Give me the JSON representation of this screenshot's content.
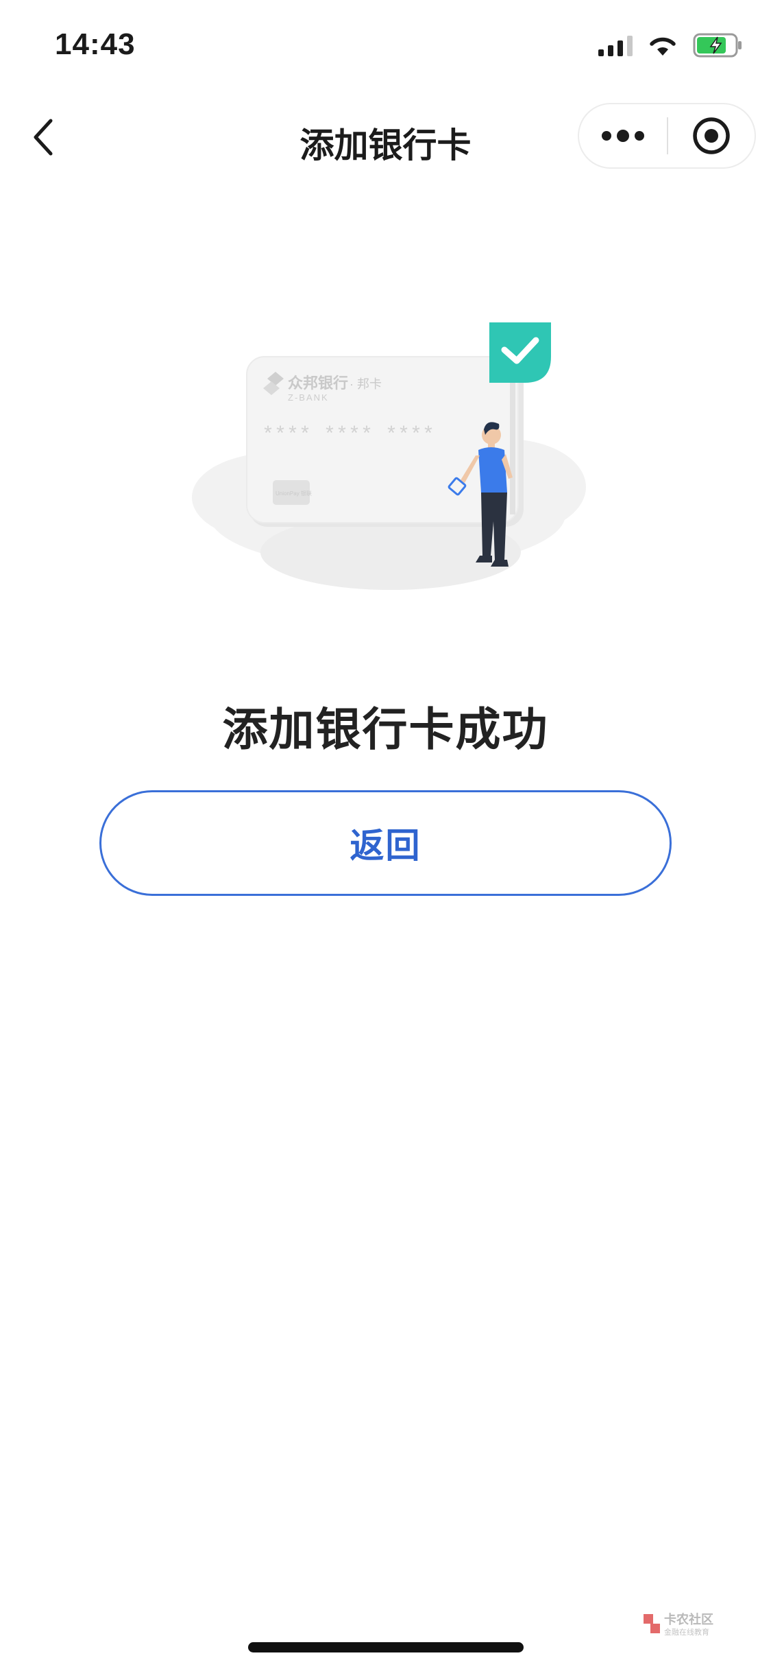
{
  "status_bar": {
    "time": "14:43"
  },
  "nav": {
    "title": "添加银行卡"
  },
  "illustration": {
    "bank_name": "众邦银行",
    "bank_suffix": "· 邦卡",
    "bank_en": "Z-BANK",
    "card_number": "****  ****  ****",
    "card_network": "UnionPay 银联"
  },
  "main": {
    "success_message": "添加银行卡成功",
    "return_label": "返回"
  },
  "watermark": {
    "title": "卡农社区",
    "subtitle": "金融在线教育"
  },
  "colors": {
    "accent": "#2f64cf",
    "check_badge": "#2fc6b4"
  }
}
